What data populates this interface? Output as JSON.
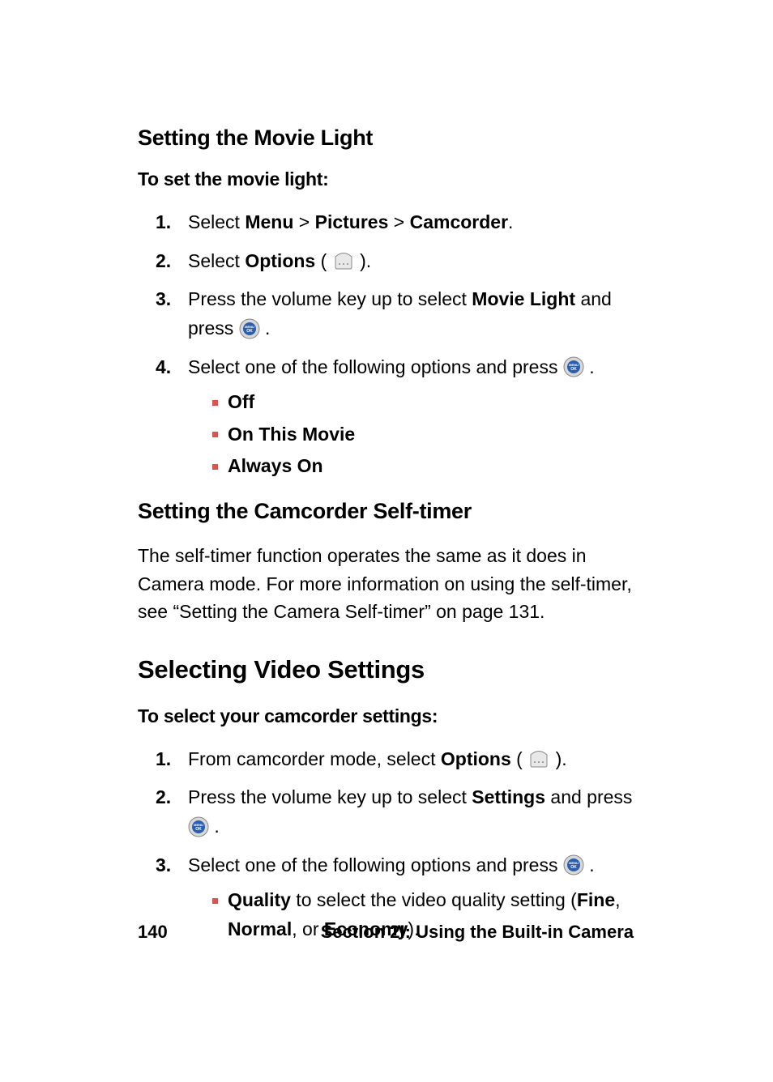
{
  "sections": {
    "movieLight": {
      "heading": "Setting the Movie Light",
      "intro": "To set the movie light:",
      "steps": {
        "s1": {
          "num": "1.",
          "a": "Select ",
          "b": "Menu",
          "c": " > ",
          "d": "Pictures",
          "e": " > ",
          "f": "Camcorder",
          "g": "."
        },
        "s2": {
          "num": "2.",
          "a": "Select ",
          "b": "Options",
          "c": " (",
          "d": ")."
        },
        "s3": {
          "num": "3.",
          "a": "Press the volume key up to select ",
          "b": "Movie Light",
          "c": " and press ",
          "d": "."
        },
        "s4": {
          "num": "4.",
          "a": "Select one of the following options and press ",
          "b": "."
        }
      },
      "options": {
        "o1": "Off",
        "o2": "On This Movie",
        "o3": "Always On"
      }
    },
    "selfTimer": {
      "heading": "Setting the Camcorder Self-timer",
      "body": "The self-timer function operates the same as it does in Camera mode. For more information on using the self-timer, see “Setting the Camera Self-timer” on page 131."
    },
    "videoSettings": {
      "heading": "Selecting Video Settings",
      "intro": "To select your camcorder settings:",
      "steps": {
        "s1": {
          "num": "1.",
          "a": "From camcorder mode, select ",
          "b": "Options",
          "c": " (",
          "d": ")."
        },
        "s2": {
          "num": "2.",
          "a": "Press the volume key up to select ",
          "b": "Settings",
          "c": " and press ",
          "d": "."
        },
        "s3": {
          "num": "3.",
          "a": "Select one of the following options and press ",
          "b": "."
        }
      },
      "options": {
        "o1": {
          "a": "Quality",
          "b": " to select the video quality setting (",
          "c": "Fine",
          "d": ", ",
          "e": "Normal",
          "f": ", or ",
          "g": "Economy",
          "h": ")."
        }
      }
    }
  },
  "footer": {
    "page": "140",
    "section": "Section 2I: Using the Built-in Camera"
  }
}
